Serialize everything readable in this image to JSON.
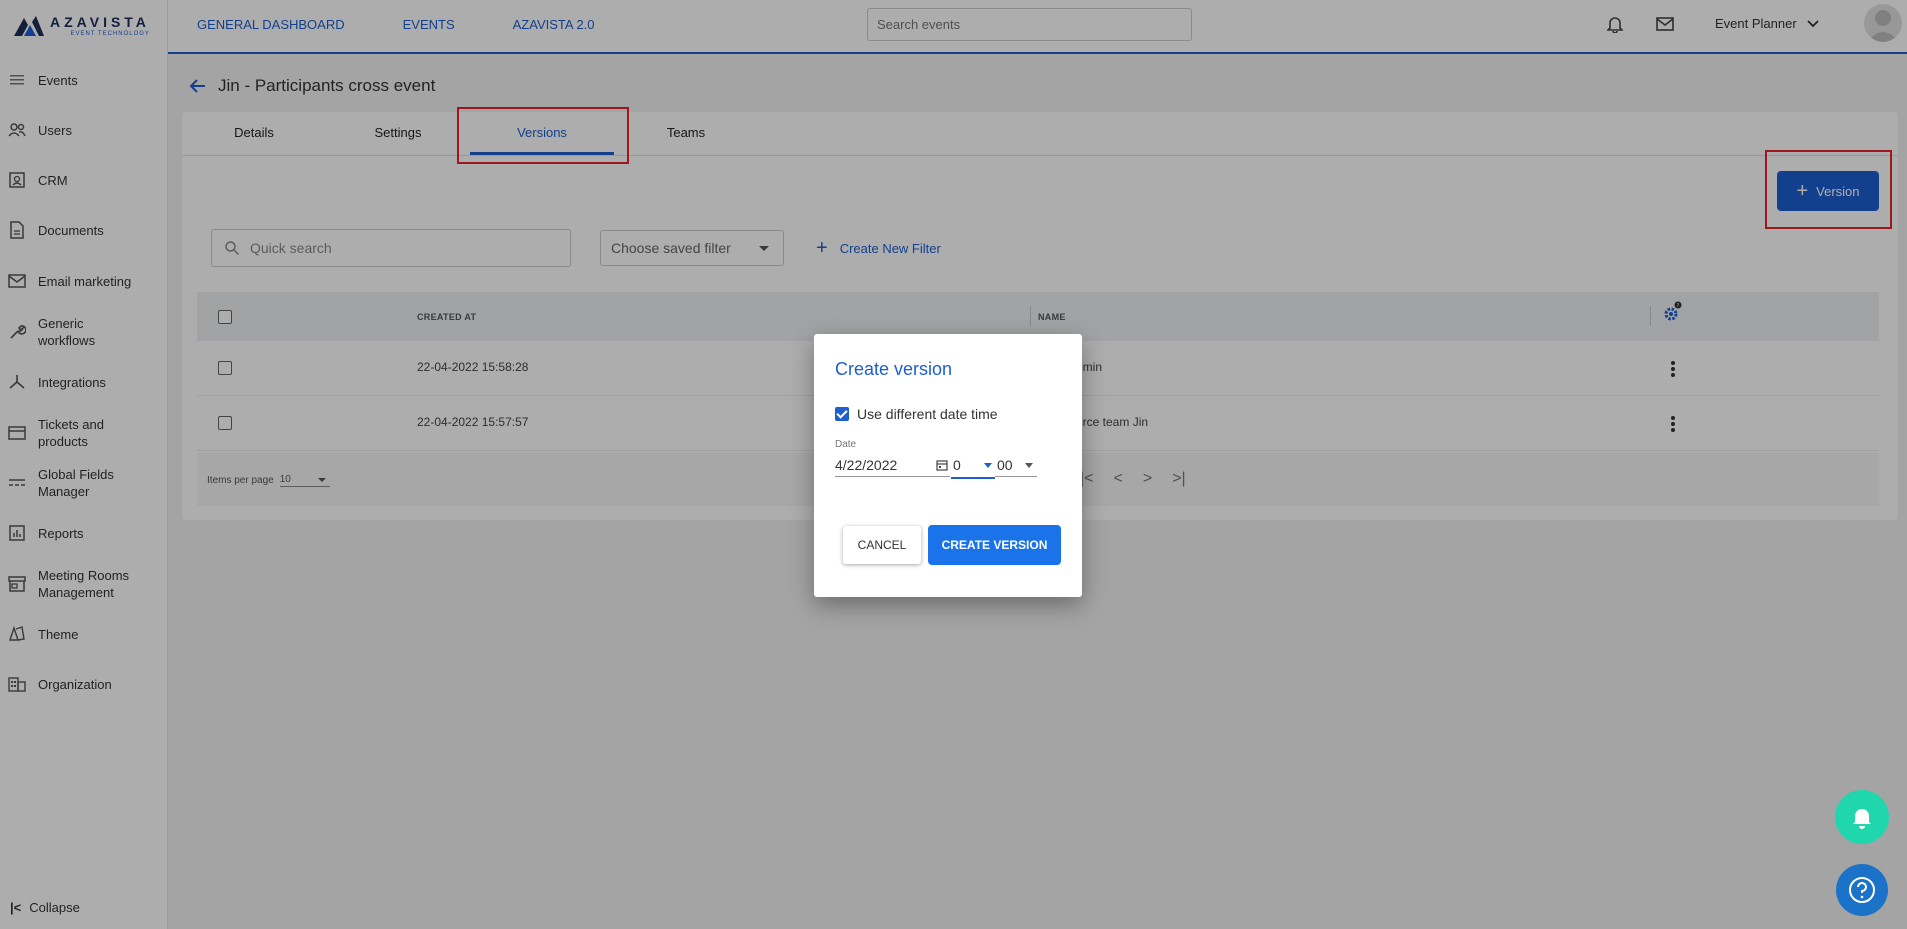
{
  "brand": {
    "name": "AZAVISTA",
    "tagline": "EVENT TECHNOLOGY"
  },
  "sidebar": {
    "items": [
      {
        "label": "Events",
        "icon": "list-icon"
      },
      {
        "label": "Users",
        "icon": "users-icon"
      },
      {
        "label": "CRM",
        "icon": "contact-card-icon"
      },
      {
        "label": "Documents",
        "icon": "document-icon"
      },
      {
        "label": "Email marketing",
        "icon": "mail-icon"
      },
      {
        "label": "Generic workflows",
        "icon": "wrench-icon"
      },
      {
        "label": "Integrations",
        "icon": "integrations-icon"
      },
      {
        "label": "Tickets and products",
        "icon": "ticket-icon"
      },
      {
        "label": "Global Fields Manager",
        "icon": "fields-icon"
      },
      {
        "label": "Reports",
        "icon": "reports-icon"
      },
      {
        "label": "Meeting Rooms Management",
        "icon": "store-icon"
      },
      {
        "label": "Theme",
        "icon": "palette-icon"
      },
      {
        "label": "Organization",
        "icon": "building-icon"
      }
    ],
    "collapse_label": "Collapse"
  },
  "topbar": {
    "nav": [
      "GENERAL DASHBOARD",
      "EVENTS",
      "AZAVISTA 2.0"
    ],
    "search_placeholder": "Search events",
    "user_role": "Event Planner"
  },
  "page": {
    "title": "Jin - Participants cross event",
    "tabs": [
      "Details",
      "Settings",
      "Versions",
      "Teams"
    ],
    "active_tab": "Versions",
    "add_version_label": "Version",
    "quick_search_placeholder": "Quick search",
    "saved_filter_placeholder": "Choose saved filter",
    "create_filter_label": "Create New Filter"
  },
  "table": {
    "columns": [
      "CREATED AT",
      "NAME"
    ],
    "rows": [
      {
        "created_at": "22-04-2022 15:58:28",
        "name": "dmin"
      },
      {
        "created_at": "22-04-2022 15:57:57",
        "name": "urce team Jin"
      }
    ],
    "items_per_page_label": "Items per page",
    "items_per_page_value": "10"
  },
  "dialog": {
    "title": "Create version",
    "checkbox_label": "Use different date time",
    "checkbox_checked": true,
    "date_label": "Date",
    "date_value": "4/22/2022",
    "hour_value": "0",
    "minute_value": "00",
    "cancel_label": "CANCEL",
    "create_label": "CREATE VERSION"
  },
  "colors": {
    "primary": "#1d5fd0",
    "button_blue": "#1a73e8",
    "highlight_red": "#e8232a",
    "fab_green": "#1fd6ad"
  }
}
